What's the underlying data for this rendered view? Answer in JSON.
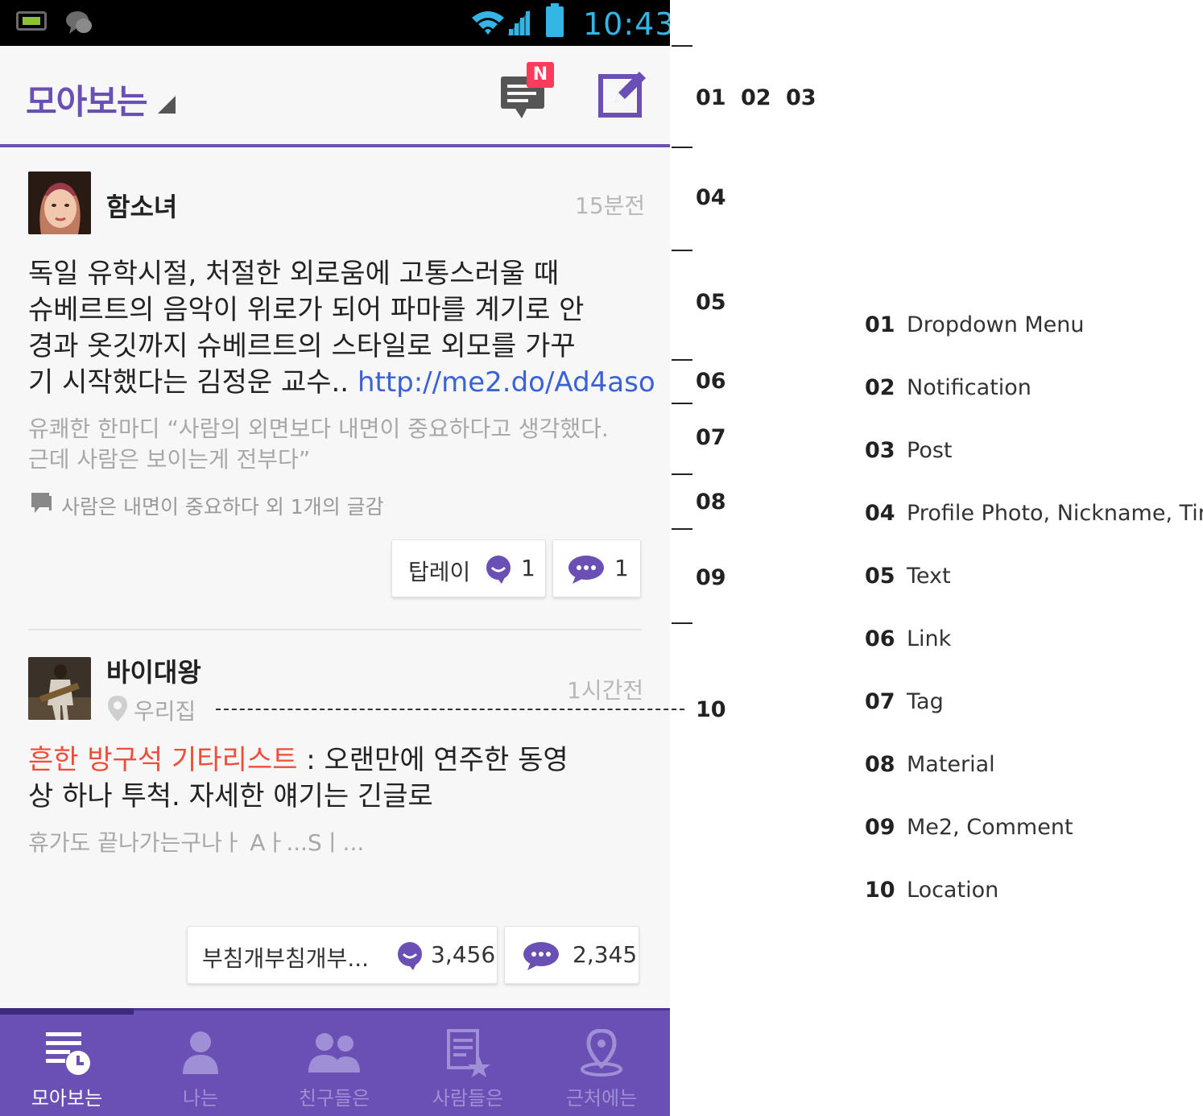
{
  "status_bar": {
    "time": "10:43"
  },
  "action_bar": {
    "title": "모아보는",
    "notification_badge": "N"
  },
  "posts": [
    {
      "nickname": "함소녀",
      "time": "15분전",
      "text_lines": [
        "독일 유학시절, 처절한 외로움에 고통스러울 때",
        "슈베르트의 음악이 위로가 되어 파마를 계기로 안",
        "경과 옷깃까지 슈베르트의 스타일로 외모를 가꾸"
      ],
      "text_last": "기 시작했다는 김정운 교수..",
      "link": "http://me2.do/Ad4aso",
      "sub_lines": [
        "유쾌한 한마디 “사람의 외면보다 내면이 중요하다고 생각했다.",
        "근데 사람은 보이는게 전부다”"
      ],
      "material": "사람은 내면이 중요하다 외 1개의 글감",
      "me2_label": "탑레이",
      "me2_count": "1",
      "comment_count": "1"
    },
    {
      "nickname": "바이대왕",
      "location": "우리집",
      "time": "1시간전",
      "tag": "흔한 방구석 기타리스트",
      "text_first_rest": " : 오랜만에 연주한 동영",
      "text_line2": "상 하나 투척. 자세한 얘기는 긴글로",
      "sub": "휴가도 끝나가는구나ㅏ Aㅏ...Sㅣ...",
      "me2_label": "부침개부침개부...",
      "me2_count": "3,456",
      "comment_count": "2,345"
    }
  ],
  "tabs": [
    {
      "label": "모아보는",
      "icon": "timeline-icon",
      "active": true
    },
    {
      "label": "나는",
      "icon": "person-icon",
      "active": false
    },
    {
      "label": "친구들은",
      "icon": "friends-icon",
      "active": false
    },
    {
      "label": "사람들은",
      "icon": "document-star-icon",
      "active": false
    },
    {
      "label": "근처에는",
      "icon": "location-pin-icon",
      "active": false
    }
  ],
  "annotations": {
    "side_numbers": [
      "01",
      "02",
      "03",
      "04",
      "05",
      "06",
      "07",
      "08",
      "09",
      "10"
    ]
  },
  "legend": [
    {
      "num": "01",
      "label": "Dropdown Menu"
    },
    {
      "num": "02",
      "label": "Notification"
    },
    {
      "num": "03",
      "label": "Post"
    },
    {
      "num": "04",
      "label": "Profile Photo, Nickname, Time"
    },
    {
      "num": "05",
      "label": "Text"
    },
    {
      "num": "06",
      "label": "Link"
    },
    {
      "num": "07",
      "label": "Tag"
    },
    {
      "num": "08",
      "label": "Material"
    },
    {
      "num": "09",
      "label": "Me2, Comment"
    },
    {
      "num": "10",
      "label": "Location"
    }
  ],
  "colors": {
    "brand_purple": "#6a4fb4",
    "link_blue": "#3a62d6",
    "tag_red": "#ef4d3a",
    "badge_red": "#ff3b5c",
    "status_blue": "#33b5e5"
  }
}
